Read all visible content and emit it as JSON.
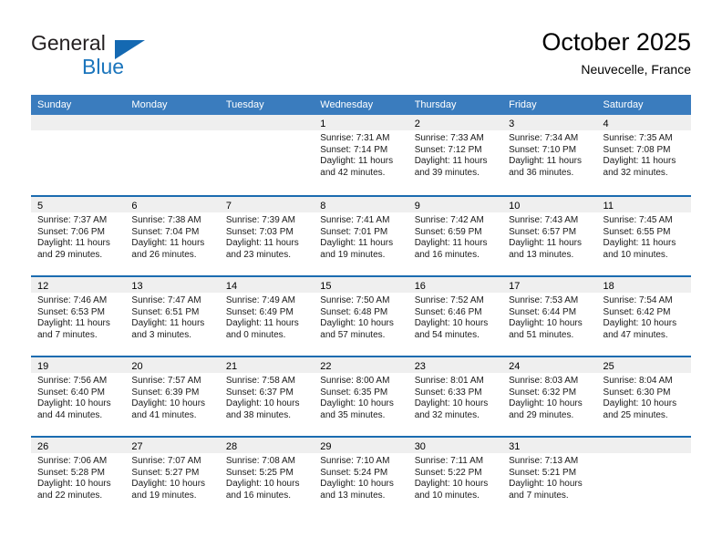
{
  "brand": {
    "name_top": "General",
    "name_bottom": "Blue",
    "accent_color": "#1b75bc",
    "triangle_color": "#1469b2"
  },
  "header": {
    "title": "October 2025",
    "subtitle": "Neuvecelle, France",
    "header_bg": "#3a7cbe",
    "row_border": "#1b6cb0",
    "daynum_bg": "#efefef"
  },
  "weekdays": [
    "Sunday",
    "Monday",
    "Tuesday",
    "Wednesday",
    "Thursday",
    "Friday",
    "Saturday"
  ],
  "weeks": [
    [
      {
        "day": "",
        "empty": true,
        "sunrise": "",
        "sunset": "",
        "daylight_line1": "",
        "daylight_line2": ""
      },
      {
        "day": "",
        "empty": true,
        "sunrise": "",
        "sunset": "",
        "daylight_line1": "",
        "daylight_line2": ""
      },
      {
        "day": "",
        "empty": true,
        "sunrise": "",
        "sunset": "",
        "daylight_line1": "",
        "daylight_line2": ""
      },
      {
        "day": "1",
        "empty": false,
        "sunrise": "Sunrise: 7:31 AM",
        "sunset": "Sunset: 7:14 PM",
        "daylight_line1": "Daylight: 11 hours",
        "daylight_line2": "and 42 minutes."
      },
      {
        "day": "2",
        "empty": false,
        "sunrise": "Sunrise: 7:33 AM",
        "sunset": "Sunset: 7:12 PM",
        "daylight_line1": "Daylight: 11 hours",
        "daylight_line2": "and 39 minutes."
      },
      {
        "day": "3",
        "empty": false,
        "sunrise": "Sunrise: 7:34 AM",
        "sunset": "Sunset: 7:10 PM",
        "daylight_line1": "Daylight: 11 hours",
        "daylight_line2": "and 36 minutes."
      },
      {
        "day": "4",
        "empty": false,
        "sunrise": "Sunrise: 7:35 AM",
        "sunset": "Sunset: 7:08 PM",
        "daylight_line1": "Daylight: 11 hours",
        "daylight_line2": "and 32 minutes."
      }
    ],
    [
      {
        "day": "5",
        "empty": false,
        "sunrise": "Sunrise: 7:37 AM",
        "sunset": "Sunset: 7:06 PM",
        "daylight_line1": "Daylight: 11 hours",
        "daylight_line2": "and 29 minutes."
      },
      {
        "day": "6",
        "empty": false,
        "sunrise": "Sunrise: 7:38 AM",
        "sunset": "Sunset: 7:04 PM",
        "daylight_line1": "Daylight: 11 hours",
        "daylight_line2": "and 26 minutes."
      },
      {
        "day": "7",
        "empty": false,
        "sunrise": "Sunrise: 7:39 AM",
        "sunset": "Sunset: 7:03 PM",
        "daylight_line1": "Daylight: 11 hours",
        "daylight_line2": "and 23 minutes."
      },
      {
        "day": "8",
        "empty": false,
        "sunrise": "Sunrise: 7:41 AM",
        "sunset": "Sunset: 7:01 PM",
        "daylight_line1": "Daylight: 11 hours",
        "daylight_line2": "and 19 minutes."
      },
      {
        "day": "9",
        "empty": false,
        "sunrise": "Sunrise: 7:42 AM",
        "sunset": "Sunset: 6:59 PM",
        "daylight_line1": "Daylight: 11 hours",
        "daylight_line2": "and 16 minutes."
      },
      {
        "day": "10",
        "empty": false,
        "sunrise": "Sunrise: 7:43 AM",
        "sunset": "Sunset: 6:57 PM",
        "daylight_line1": "Daylight: 11 hours",
        "daylight_line2": "and 13 minutes."
      },
      {
        "day": "11",
        "empty": false,
        "sunrise": "Sunrise: 7:45 AM",
        "sunset": "Sunset: 6:55 PM",
        "daylight_line1": "Daylight: 11 hours",
        "daylight_line2": "and 10 minutes."
      }
    ],
    [
      {
        "day": "12",
        "empty": false,
        "sunrise": "Sunrise: 7:46 AM",
        "sunset": "Sunset: 6:53 PM",
        "daylight_line1": "Daylight: 11 hours",
        "daylight_line2": "and 7 minutes."
      },
      {
        "day": "13",
        "empty": false,
        "sunrise": "Sunrise: 7:47 AM",
        "sunset": "Sunset: 6:51 PM",
        "daylight_line1": "Daylight: 11 hours",
        "daylight_line2": "and 3 minutes."
      },
      {
        "day": "14",
        "empty": false,
        "sunrise": "Sunrise: 7:49 AM",
        "sunset": "Sunset: 6:49 PM",
        "daylight_line1": "Daylight: 11 hours",
        "daylight_line2": "and 0 minutes."
      },
      {
        "day": "15",
        "empty": false,
        "sunrise": "Sunrise: 7:50 AM",
        "sunset": "Sunset: 6:48 PM",
        "daylight_line1": "Daylight: 10 hours",
        "daylight_line2": "and 57 minutes."
      },
      {
        "day": "16",
        "empty": false,
        "sunrise": "Sunrise: 7:52 AM",
        "sunset": "Sunset: 6:46 PM",
        "daylight_line1": "Daylight: 10 hours",
        "daylight_line2": "and 54 minutes."
      },
      {
        "day": "17",
        "empty": false,
        "sunrise": "Sunrise: 7:53 AM",
        "sunset": "Sunset: 6:44 PM",
        "daylight_line1": "Daylight: 10 hours",
        "daylight_line2": "and 51 minutes."
      },
      {
        "day": "18",
        "empty": false,
        "sunrise": "Sunrise: 7:54 AM",
        "sunset": "Sunset: 6:42 PM",
        "daylight_line1": "Daylight: 10 hours",
        "daylight_line2": "and 47 minutes."
      }
    ],
    [
      {
        "day": "19",
        "empty": false,
        "sunrise": "Sunrise: 7:56 AM",
        "sunset": "Sunset: 6:40 PM",
        "daylight_line1": "Daylight: 10 hours",
        "daylight_line2": "and 44 minutes."
      },
      {
        "day": "20",
        "empty": false,
        "sunrise": "Sunrise: 7:57 AM",
        "sunset": "Sunset: 6:39 PM",
        "daylight_line1": "Daylight: 10 hours",
        "daylight_line2": "and 41 minutes."
      },
      {
        "day": "21",
        "empty": false,
        "sunrise": "Sunrise: 7:58 AM",
        "sunset": "Sunset: 6:37 PM",
        "daylight_line1": "Daylight: 10 hours",
        "daylight_line2": "and 38 minutes."
      },
      {
        "day": "22",
        "empty": false,
        "sunrise": "Sunrise: 8:00 AM",
        "sunset": "Sunset: 6:35 PM",
        "daylight_line1": "Daylight: 10 hours",
        "daylight_line2": "and 35 minutes."
      },
      {
        "day": "23",
        "empty": false,
        "sunrise": "Sunrise: 8:01 AM",
        "sunset": "Sunset: 6:33 PM",
        "daylight_line1": "Daylight: 10 hours",
        "daylight_line2": "and 32 minutes."
      },
      {
        "day": "24",
        "empty": false,
        "sunrise": "Sunrise: 8:03 AM",
        "sunset": "Sunset: 6:32 PM",
        "daylight_line1": "Daylight: 10 hours",
        "daylight_line2": "and 29 minutes."
      },
      {
        "day": "25",
        "empty": false,
        "sunrise": "Sunrise: 8:04 AM",
        "sunset": "Sunset: 6:30 PM",
        "daylight_line1": "Daylight: 10 hours",
        "daylight_line2": "and 25 minutes."
      }
    ],
    [
      {
        "day": "26",
        "empty": false,
        "sunrise": "Sunrise: 7:06 AM",
        "sunset": "Sunset: 5:28 PM",
        "daylight_line1": "Daylight: 10 hours",
        "daylight_line2": "and 22 minutes."
      },
      {
        "day": "27",
        "empty": false,
        "sunrise": "Sunrise: 7:07 AM",
        "sunset": "Sunset: 5:27 PM",
        "daylight_line1": "Daylight: 10 hours",
        "daylight_line2": "and 19 minutes."
      },
      {
        "day": "28",
        "empty": false,
        "sunrise": "Sunrise: 7:08 AM",
        "sunset": "Sunset: 5:25 PM",
        "daylight_line1": "Daylight: 10 hours",
        "daylight_line2": "and 16 minutes."
      },
      {
        "day": "29",
        "empty": false,
        "sunrise": "Sunrise: 7:10 AM",
        "sunset": "Sunset: 5:24 PM",
        "daylight_line1": "Daylight: 10 hours",
        "daylight_line2": "and 13 minutes."
      },
      {
        "day": "30",
        "empty": false,
        "sunrise": "Sunrise: 7:11 AM",
        "sunset": "Sunset: 5:22 PM",
        "daylight_line1": "Daylight: 10 hours",
        "daylight_line2": "and 10 minutes."
      },
      {
        "day": "31",
        "empty": false,
        "sunrise": "Sunrise: 7:13 AM",
        "sunset": "Sunset: 5:21 PM",
        "daylight_line1": "Daylight: 10 hours",
        "daylight_line2": "and 7 minutes."
      },
      {
        "day": "",
        "empty": true,
        "sunrise": "",
        "sunset": "",
        "daylight_line1": "",
        "daylight_line2": ""
      }
    ]
  ]
}
